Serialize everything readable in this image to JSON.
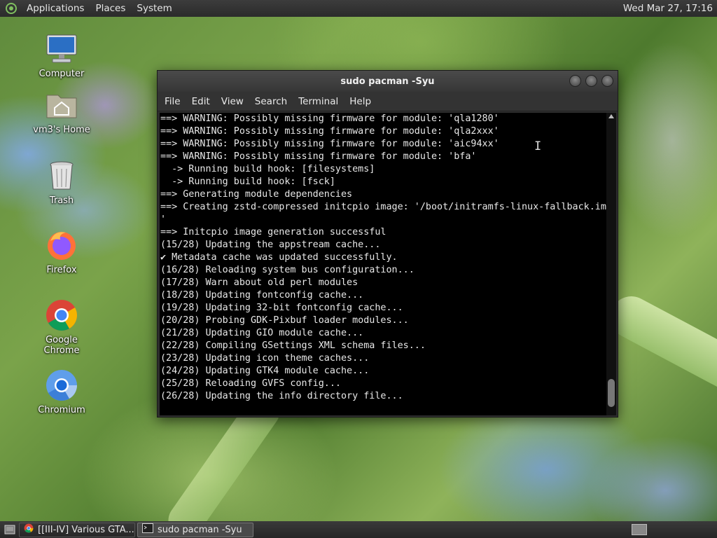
{
  "top_panel": {
    "menus": [
      "Applications",
      "Places",
      "System"
    ],
    "clock": "Wed Mar 27, 17:16"
  },
  "desktop_icons": [
    {
      "label": "Computer",
      "icon": "computer-icon"
    },
    {
      "label": "vm3's Home",
      "icon": "home-folder-icon"
    },
    {
      "label": "Trash",
      "icon": "trash-icon"
    },
    {
      "label": "Firefox",
      "icon": "firefox-icon"
    },
    {
      "label": "Google Chrome",
      "icon": "chrome-icon"
    },
    {
      "label": "Chromium",
      "icon": "chromium-icon"
    }
  ],
  "terminal": {
    "title": "sudo pacman -Syu",
    "menu": [
      "File",
      "Edit",
      "View",
      "Search",
      "Terminal",
      "Help"
    ],
    "lines": [
      "==> WARNING: Possibly missing firmware for module: 'qla1280'",
      "==> WARNING: Possibly missing firmware for module: 'qla2xxx'",
      "==> WARNING: Possibly missing firmware for module: 'aic94xx'",
      "==> WARNING: Possibly missing firmware for module: 'bfa'",
      "  -> Running build hook: [filesystems]",
      "  -> Running build hook: [fsck]",
      "==> Generating module dependencies",
      "==> Creating zstd-compressed initcpio image: '/boot/initramfs-linux-fallback.img",
      "'",
      "==> Initcpio image generation successful",
      "(15/28) Updating the appstream cache...",
      "✔ Metadata cache was updated successfully.",
      "(16/28) Reloading system bus configuration...",
      "(17/28) Warn about old perl modules",
      "(18/28) Updating fontconfig cache...",
      "(19/28) Updating 32-bit fontconfig cache...",
      "(20/28) Probing GDK-Pixbuf loader modules...",
      "(21/28) Updating GIO module cache...",
      "(22/28) Compiling GSettings XML schema files...",
      "(23/28) Updating icon theme caches...",
      "(24/28) Updating GTK4 module cache...",
      "(25/28) Reloading GVFS config...",
      "(26/28) Updating the info directory file..."
    ]
  },
  "taskbar": {
    "items": [
      {
        "label": "[[III-IV] Various GTA...",
        "icon": "chrome-icon",
        "active": false
      },
      {
        "label": "sudo pacman -Syu",
        "icon": "terminal-icon",
        "active": true
      }
    ]
  }
}
